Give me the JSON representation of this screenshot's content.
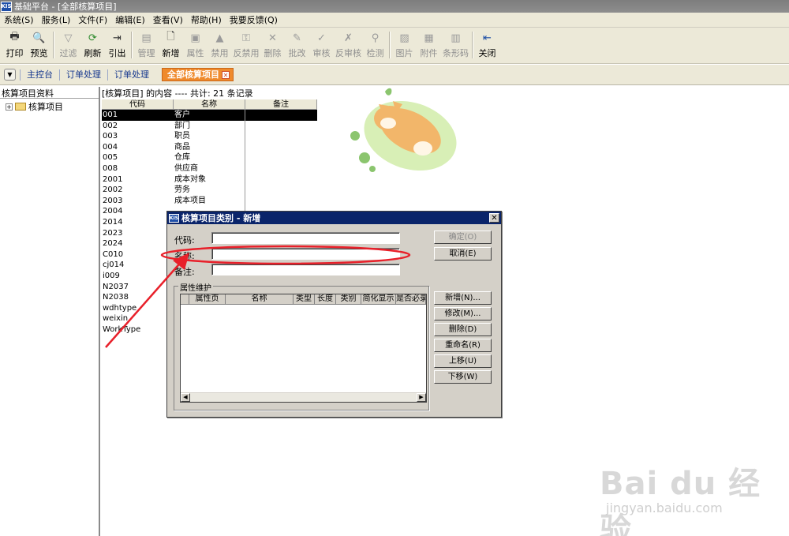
{
  "window": {
    "logo": "KIS",
    "title": "基础平台 - [全部核算项目]"
  },
  "menu": [
    "系统(S)",
    "服务(L)",
    "文件(F)",
    "编辑(E)",
    "查看(V)",
    "帮助(H)",
    "我要反馈(Q)"
  ],
  "toolbar": {
    "print": "打印",
    "preview": "预览",
    "filter": "过滤",
    "refresh": "刷新",
    "export": "引出",
    "manage": "管理",
    "new": "新增",
    "properties": "属性",
    "disable": "禁用",
    "unban": "反禁用",
    "delete": "删除",
    "batch_modify": "批改",
    "audit": "审核",
    "unaudit": "反审核",
    "check": "检测",
    "image": "图片",
    "attachment": "附件",
    "barcode": "条形码",
    "close": "关闭"
  },
  "tabs": [
    "主控台",
    "订单处理",
    "订单处理"
  ],
  "active_tab": "全部核算项目",
  "left_panel": {
    "header": "核算项目资料",
    "tree_root": "核算项目"
  },
  "content": {
    "summary": "[核算项目] 的内容 ---- 共计: 21 条记录",
    "columns": [
      "代码",
      "名称",
      "备注"
    ],
    "rows": [
      [
        "001",
        "客户"
      ],
      [
        "002",
        "部门"
      ],
      [
        "003",
        "职员"
      ],
      [
        "004",
        "商品"
      ],
      [
        "005",
        "仓库"
      ],
      [
        "008",
        "供应商"
      ],
      [
        "2001",
        "成本对象"
      ],
      [
        "2002",
        "劳务"
      ],
      [
        "2003",
        "成本项目"
      ],
      [
        "2004",
        ""
      ],
      [
        "2014",
        ""
      ],
      [
        "2023",
        ""
      ],
      [
        "2024",
        ""
      ],
      [
        "C010",
        ""
      ],
      [
        "cj014",
        ""
      ],
      [
        "i009",
        ""
      ],
      [
        "N2037",
        ""
      ],
      [
        "N2038",
        ""
      ],
      [
        "wdhtype",
        ""
      ],
      [
        "weixin",
        ""
      ],
      [
        "WorkType",
        ""
      ]
    ]
  },
  "dialog": {
    "title": "核算项目类别 - 新增",
    "code_label": "代码:",
    "name_label": "名称:",
    "note_label": "备注:",
    "ok": "确定(O)",
    "cancel": "取消(E)",
    "group_title": "属性维护",
    "attr_columns": [
      "属性页",
      "名称",
      "类型",
      "长度",
      "类别",
      "简化显示",
      "是否必录"
    ],
    "btn_new": "新增(N)...",
    "btn_modify": "修改(M)...",
    "btn_delete": "删除(D)",
    "btn_rename": "重命名(R)",
    "btn_up": "上移(U)",
    "btn_down": "下移(W)"
  },
  "watermark": {
    "logo": "Bai du 经验",
    "url": "jingyan.baidu.com"
  },
  "colors": {
    "accent_tab": "#ef8a2c",
    "dialog_title": "#0a246a",
    "annotation": "#e8202a"
  }
}
